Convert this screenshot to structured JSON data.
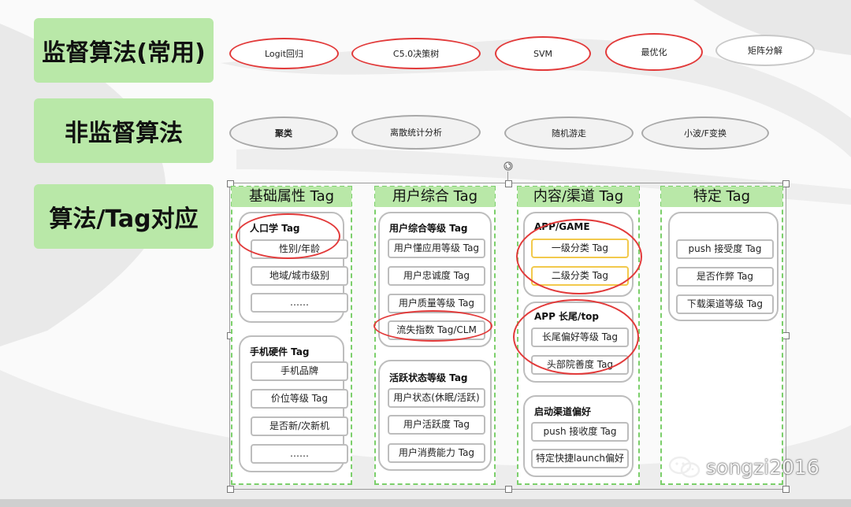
{
  "rows": {
    "supervised": "监督算法(常用)",
    "unsupervised": "非监督算法",
    "mapping": "算法/Tag对应"
  },
  "supervised_algos": [
    "Logit回归",
    "C5.0决策树",
    "SVM",
    "最优化",
    "矩阵分解"
  ],
  "unsupervised_algos": [
    "聚类",
    "离散统计分析",
    "随机游走",
    "小波/F变换"
  ],
  "panels": [
    {
      "header": "基础属性 Tag",
      "groups": [
        {
          "title": "人口学 Tag",
          "items": [
            "性别/年龄",
            "地域/城市级别",
            "……"
          ]
        },
        {
          "title": "手机硬件 Tag",
          "items": [
            "手机品牌",
            "价位等级 Tag",
            "是否新/次新机",
            "……"
          ]
        }
      ]
    },
    {
      "header": "用户综合 Tag",
      "groups": [
        {
          "title": "用户综合等级 Tag",
          "items": [
            "用户懂应用等级 Tag",
            "用户忠诚度 Tag",
            "用户质量等级 Tag",
            "流失指数 Tag/CLM"
          ]
        },
        {
          "title": "活跃状态等级 Tag",
          "items": [
            "用户状态(休眠/活跃)",
            "用户活跃度 Tag",
            "用户消费能力 Tag"
          ]
        }
      ]
    },
    {
      "header": "内容/渠道 Tag",
      "groups": [
        {
          "title": "APP/GAME",
          "items": [
            "一级分类 Tag",
            "二级分类 Tag"
          ]
        },
        {
          "title": "APP 长尾/top",
          "items": [
            "长尾偏好等级 Tag",
            "头部院善度 Tag"
          ]
        },
        {
          "title": "启动渠道偏好",
          "items": [
            "push 接收度 Tag",
            "特定快捷launch偏好"
          ]
        }
      ]
    },
    {
      "header": "特定 Tag",
      "groups": [
        {
          "title": "",
          "items": [
            "push 接受度 Tag",
            "是否作弊 Tag",
            "下载渠道等级 Tag"
          ]
        }
      ]
    }
  ],
  "watermark": "songzi2016",
  "colors": {
    "label_green": "#b9e8a8",
    "highlight_red": "#e23a3a",
    "dash_green": "#7ccf6b"
  }
}
